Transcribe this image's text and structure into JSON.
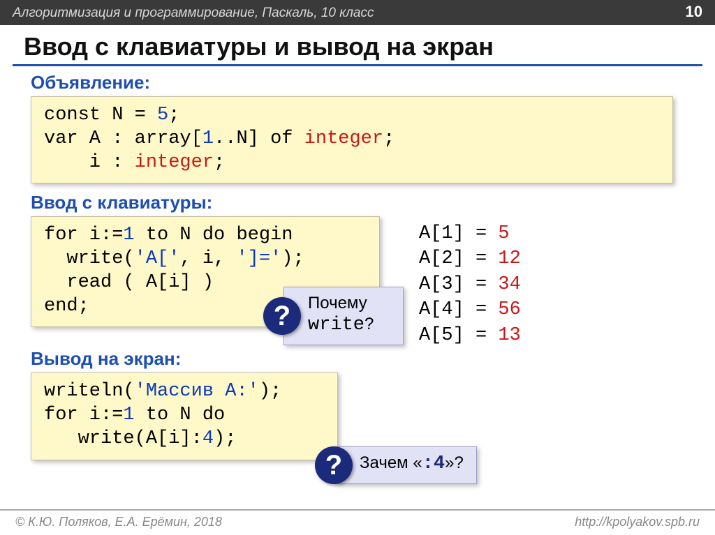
{
  "topbar": {
    "breadcrumb": "Алгоритмизация и программирование, Паскаль, 10 класс",
    "pagenum": "10"
  },
  "title": "Ввод с клавиатуры и вывод на экран",
  "sections": {
    "declaration_label": "Объявление:",
    "input_label": "Ввод с клавиатуры:",
    "output_label": "Вывод на экран:"
  },
  "code": {
    "decl": {
      "l1a": "const N",
      "l1b": "=",
      "l1c": "5",
      "l1d": ";",
      "l2a": "var A",
      "l2b": ":",
      "l2c": "array[",
      "l2d": "1",
      "l2e": "..N]",
      "l2f": "of ",
      "l2g": "integer",
      "l2h": ";",
      "l3a": "    i",
      "l3b": ":",
      "l3c": "integer",
      "l3d": ";"
    },
    "in": {
      "l1a": "for i:=",
      "l1b": "1",
      "l1c": " to N do begin",
      "l2a": "  write(",
      "l2b": "'A['",
      "l2c": ", i, ",
      "l2d": "']='",
      "l2e": ");",
      "l3": "  read ( A[i] )",
      "l4": "end;"
    },
    "out": {
      "l1a": "writeln(",
      "l1b": "'Массив A:'",
      "l1c": ");",
      "l2a": "for i:=",
      "l2b": "1",
      "l2c": " to N do ",
      "l3a": "   write(A[i]:",
      "l3b": "4",
      "l3c": ");"
    }
  },
  "sample_output": [
    {
      "k": "A[1]",
      "eq": "=",
      "v": "5"
    },
    {
      "k": "A[2]",
      "eq": "=",
      "v": "12"
    },
    {
      "k": "A[3]",
      "eq": "=",
      "v": "34"
    },
    {
      "k": "A[4]",
      "eq": "=",
      "v": "56"
    },
    {
      "k": "A[5]",
      "eq": "=",
      "v": "13"
    }
  ],
  "callouts": {
    "c1_line1": "Почему",
    "c1_line2": "write",
    "c1_q": "?",
    "c2_text_a": "Зачем «",
    "c2_text_b": ":4",
    "c2_text_c": "»?",
    "qmark": "?"
  },
  "footer": {
    "left": "© К.Ю. Поляков, Е.А. Ерёмин, 2018",
    "right": "http://kpolyakov.spb.ru"
  }
}
